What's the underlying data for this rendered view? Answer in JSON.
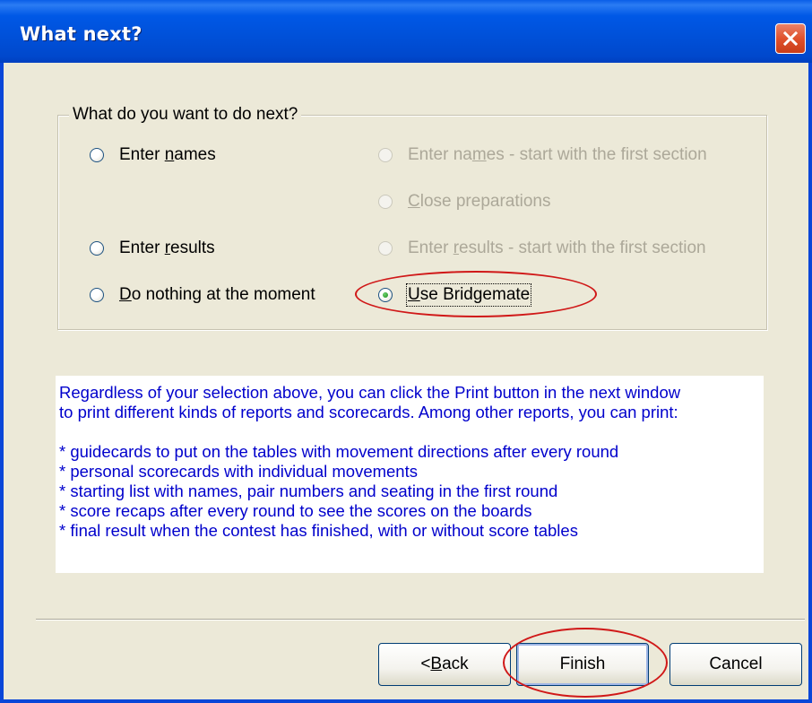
{
  "window": {
    "title": "What next?"
  },
  "group": {
    "legend": "What do you want to do next?",
    "options": {
      "enter_names": {
        "before": "Enter ",
        "accel": "n",
        "after": "ames"
      },
      "enter_names_first_section": {
        "before": "Enter na",
        "accel": "m",
        "after": "es - start with the first section"
      },
      "close_preparations": {
        "before": "",
        "accel": "C",
        "after": "lose preparations"
      },
      "enter_results": {
        "before": "Enter ",
        "accel": "r",
        "after": "esults"
      },
      "enter_results_first_section": {
        "before": "Enter ",
        "accel": "r",
        "after": "esults - start with the first section"
      },
      "do_nothing": {
        "before": "",
        "accel": "D",
        "after": "o nothing at the moment"
      },
      "use_bridgemate": {
        "before": "",
        "accel": "U",
        "after": "se Bridgemate"
      }
    },
    "selected": "Use Bridgemate"
  },
  "info": {
    "paragraph": [
      "Regardless of your selection above, you can click the Print button in the next window",
      "to print different kinds of reports and scorecards. Among other reports, you can print:"
    ],
    "bullets": [
      "* guidecards to put on the tables with movement directions after every round",
      "* personal scorecards with individual movements",
      "* starting list with names, pair numbers and seating in the first round",
      "* score recaps after every round to see the scores on the boards",
      "* final result when the contest has finished, with or without score tables"
    ]
  },
  "buttons": {
    "back": {
      "before": "< ",
      "accel": "B",
      "after": "ack"
    },
    "finish": "Finish",
    "cancel": "Cancel"
  },
  "colors": {
    "titlebar": "#0054e3",
    "dialog_bg": "#ece9d8",
    "info_text": "#0000cc",
    "annotation": "#d01818"
  }
}
